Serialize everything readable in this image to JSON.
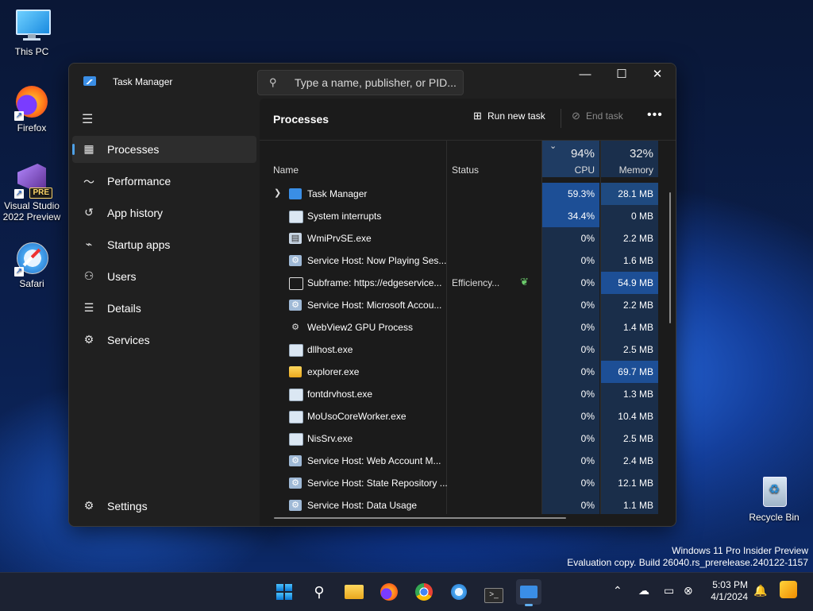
{
  "desktop": {
    "icons": [
      {
        "label": "This PC"
      },
      {
        "label": "Firefox"
      },
      {
        "label": "Visual Studio 2022 Preview",
        "badge": "PRE"
      },
      {
        "label": "Safari"
      },
      {
        "label": "Recycle Bin"
      }
    ],
    "watermark": {
      "line1": "Windows 11 Pro Insider Preview",
      "line2": "Evaluation copy. Build 26040.rs_prerelease.240122-1157"
    }
  },
  "window": {
    "title": "Task Manager",
    "search_placeholder": "Type a name, publisher, or PID...",
    "controls": {
      "minimize": "—",
      "maximize": "☐",
      "close": "✕"
    }
  },
  "sidebar": {
    "items": [
      {
        "label": "Processes",
        "icon": "processes-icon",
        "active": true
      },
      {
        "label": "Performance",
        "icon": "performance-icon"
      },
      {
        "label": "App history",
        "icon": "app-history-icon"
      },
      {
        "label": "Startup apps",
        "icon": "startup-apps-icon"
      },
      {
        "label": "Users",
        "icon": "users-icon"
      },
      {
        "label": "Details",
        "icon": "details-icon"
      },
      {
        "label": "Services",
        "icon": "services-icon"
      }
    ],
    "settings_label": "Settings"
  },
  "processes": {
    "title": "Processes",
    "run_new_task": "Run new task",
    "end_task": "End task",
    "columns": {
      "name": "Name",
      "status": "Status",
      "cpu_pct": "94%",
      "cpu": "CPU",
      "mem_pct": "32%",
      "memory": "Memory"
    },
    "rows": [
      {
        "name": "Task Manager",
        "status": "",
        "cpu": "59.3%",
        "mem": "28.1 MB",
        "expandable": true,
        "icon": "task-manager-icon",
        "cpu_level": 2,
        "mem_level": 1
      },
      {
        "name": "System interrupts",
        "status": "",
        "cpu": "34.4%",
        "mem": "0 MB",
        "icon": "window-icon",
        "cpu_level": 2,
        "mem_level": 0
      },
      {
        "name": "WmiPrvSE.exe",
        "status": "",
        "cpu": "0%",
        "mem": "2.2 MB",
        "icon": "wmi-icon",
        "cpu_level": 0,
        "mem_level": 0
      },
      {
        "name": "Service Host: Now Playing Ses...",
        "status": "",
        "cpu": "0%",
        "mem": "1.6 MB",
        "icon": "service-host-icon",
        "cpu_level": 0,
        "mem_level": 0
      },
      {
        "name": "Subframe: https://edgeservice...",
        "status": "Efficiency...",
        "cpu": "0%",
        "mem": "54.9 MB",
        "icon": "subframe-icon",
        "leaf": true,
        "cpu_level": 0,
        "mem_level": 2
      },
      {
        "name": "Service Host: Microsoft Accou...",
        "status": "",
        "cpu": "0%",
        "mem": "2.2 MB",
        "icon": "service-host-icon",
        "cpu_level": 0,
        "mem_level": 0
      },
      {
        "name": "WebView2 GPU Process",
        "status": "",
        "cpu": "0%",
        "mem": "1.4 MB",
        "icon": "gear-icon",
        "cpu_level": 0,
        "mem_level": 0
      },
      {
        "name": "dllhost.exe",
        "status": "",
        "cpu": "0%",
        "mem": "2.5 MB",
        "icon": "window-icon",
        "cpu_level": 0,
        "mem_level": 0
      },
      {
        "name": "explorer.exe",
        "status": "",
        "cpu": "0%",
        "mem": "69.7 MB",
        "icon": "folder-icon",
        "cpu_level": 0,
        "mem_level": 2
      },
      {
        "name": "fontdrvhost.exe",
        "status": "",
        "cpu": "0%",
        "mem": "1.3 MB",
        "icon": "window-icon",
        "cpu_level": 0,
        "mem_level": 0
      },
      {
        "name": "MoUsoCoreWorker.exe",
        "status": "",
        "cpu": "0%",
        "mem": "10.4 MB",
        "icon": "window-icon",
        "cpu_level": 0,
        "mem_level": 0
      },
      {
        "name": "NisSrv.exe",
        "status": "",
        "cpu": "0%",
        "mem": "2.5 MB",
        "icon": "window-icon",
        "cpu_level": 0,
        "mem_level": 0
      },
      {
        "name": "Service Host: Web Account M...",
        "status": "",
        "cpu": "0%",
        "mem": "2.4 MB",
        "icon": "service-host-icon",
        "cpu_level": 0,
        "mem_level": 0
      },
      {
        "name": "Service Host: State Repository ...",
        "status": "",
        "cpu": "0%",
        "mem": "12.1 MB",
        "icon": "service-host-icon",
        "cpu_level": 0,
        "mem_level": 0
      },
      {
        "name": "Service Host: Data Usage",
        "status": "",
        "cpu": "0%",
        "mem": "1.1 MB",
        "icon": "service-host-icon",
        "cpu_level": 0,
        "mem_level": 0
      }
    ]
  },
  "taskbar": {
    "apps": [
      "start-icon",
      "search-icon",
      "file-explorer-icon",
      "firefox-icon",
      "chrome-icon",
      "safari-icon",
      "terminal-icon",
      "task-manager-icon"
    ],
    "time": "5:03 PM",
    "date": "4/1/2024"
  },
  "colors": {
    "accent": "#4ea0e6",
    "heat_low": "#1a2e4a",
    "heat_mid": "#1f4a80",
    "heat_high": "#1d4f96"
  }
}
